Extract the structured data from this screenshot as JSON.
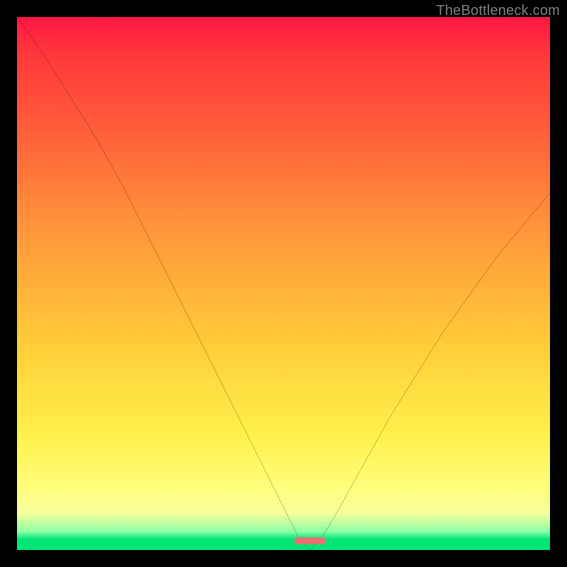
{
  "watermark": "TheBottleneck.com",
  "chart_data": {
    "type": "line",
    "title": "",
    "xlabel": "",
    "ylabel": "",
    "xlim": [
      0,
      100
    ],
    "ylim": [
      0,
      100
    ],
    "grid": false,
    "legend": false,
    "background_gradient": {
      "direction": "vertical",
      "stops": [
        {
          "pos": 0,
          "color": "#ff1744",
          "meaning": "high-bottleneck"
        },
        {
          "pos": 50,
          "color": "#ffb03a"
        },
        {
          "pos": 80,
          "color": "#fff04a"
        },
        {
          "pos": 97,
          "color": "#00e676",
          "meaning": "no-bottleneck"
        }
      ]
    },
    "series": [
      {
        "name": "bottleneck-curve",
        "color": "#000000",
        "x": [
          0,
          5,
          10,
          15,
          20,
          25,
          30,
          35,
          40,
          45,
          50,
          53,
          55,
          57,
          60,
          65,
          70,
          75,
          80,
          85,
          90,
          95,
          100
        ],
        "y": [
          100,
          93,
          85,
          77,
          68,
          58,
          48,
          38,
          28,
          18,
          8,
          2,
          0,
          2,
          7,
          16,
          25,
          33,
          41,
          48,
          55,
          61,
          67
        ]
      }
    ],
    "marker": {
      "name": "optimal-range",
      "color": "#e57373",
      "x_start": 52,
      "x_end": 58,
      "y": 0
    }
  }
}
